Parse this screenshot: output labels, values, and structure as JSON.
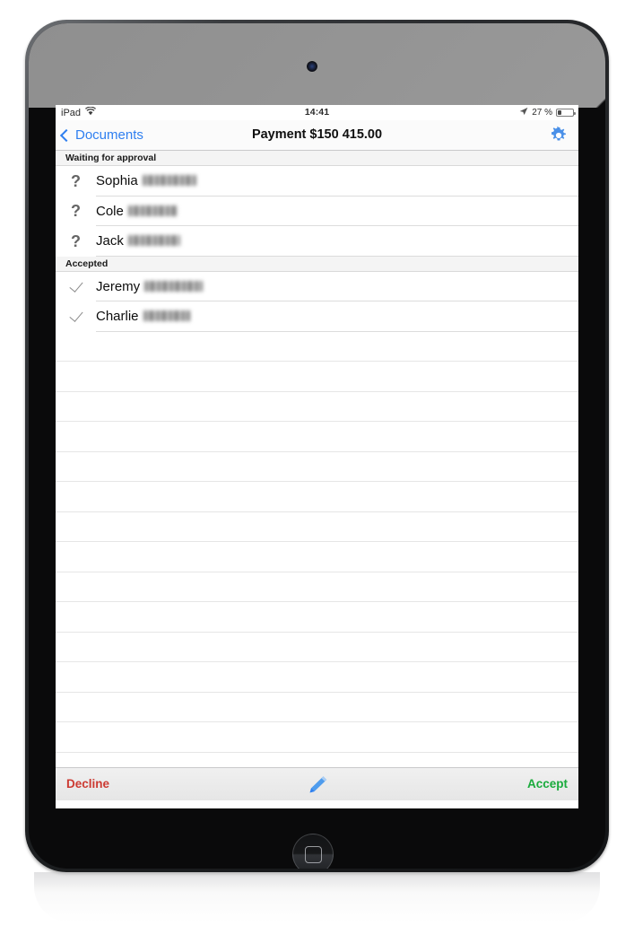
{
  "device": {
    "label": "ipad-mini",
    "camera_icon": "camera-dot",
    "home_button_icon": "home-rounded-square"
  },
  "status_bar": {
    "carrier": "iPad",
    "wifi_icon": "wifi-icon",
    "time": "14:41",
    "location_icon": "location-arrow-icon",
    "battery_text": "27 %",
    "battery_percent": 27,
    "battery_icon": "battery-icon"
  },
  "nav_bar": {
    "back_icon": "chevron-left-icon",
    "back_label": "Documents",
    "title": "Payment $150 415.00",
    "settings_icon": "gear-icon"
  },
  "list": {
    "sections": [
      {
        "header": "Waiting for approval",
        "rows": [
          {
            "status_icon": "question-mark-icon",
            "first_name": "Sophia",
            "last_name_redacted": true,
            "redaction_width": 60
          },
          {
            "status_icon": "question-mark-icon",
            "first_name": "Cole",
            "last_name_redacted": true,
            "redaction_width": 55
          },
          {
            "status_icon": "question-mark-icon",
            "first_name": "Jack",
            "last_name_redacted": true,
            "redaction_width": 58
          }
        ]
      },
      {
        "header": "Accepted",
        "rows": [
          {
            "status_icon": "checkmark-icon",
            "first_name": "Jeremy",
            "last_name_redacted": true,
            "redaction_width": 65
          },
          {
            "status_icon": "checkmark-icon",
            "first_name": "Charlie",
            "last_name_redacted": true,
            "redaction_width": 52
          }
        ]
      }
    ],
    "empty_row_count": 16
  },
  "toolbar": {
    "decline_label": "Decline",
    "sign_icon": "pencil-icon",
    "accept_label": "Accept"
  },
  "colors": {
    "tint_blue": "#2f7ff0",
    "gear_blue": "#4a90e8",
    "decline_red": "#cc3a32",
    "accept_green": "#1aab3c",
    "section_header_bg": "#f4f4f4",
    "toolbar_bg": "#e9e9e9"
  }
}
